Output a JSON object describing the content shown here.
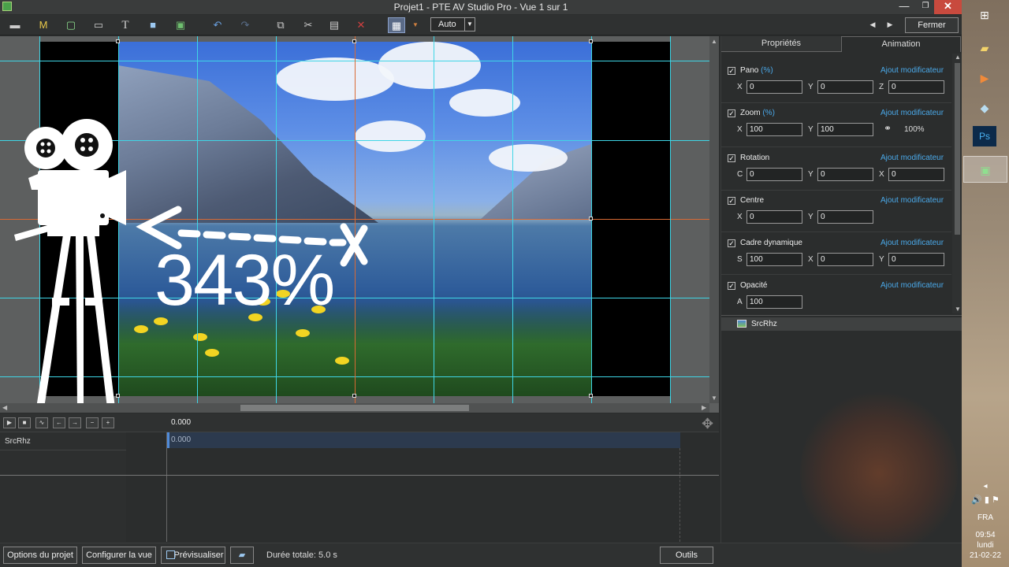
{
  "window": {
    "title": "Projet1 - PTE AV Studio Pro - Vue 1 sur 1",
    "minimize": "—",
    "maximize": "❐",
    "close": "✕"
  },
  "toolbar": {
    "m_label": "M",
    "t_label": "T",
    "auto_value": "Auto",
    "fermer_label": "Fermer"
  },
  "canvas": {
    "zoom_overlay": "343%"
  },
  "timeline": {
    "time_head": "0.000",
    "track_name": "SrcRhz",
    "track_time": "0.000"
  },
  "bottom": {
    "options_label": "Options du projet",
    "configure_label": "Configurer la vue",
    "preview_label": "Prévisualiser",
    "duration_text": "Durée totale: 5.0 s",
    "tools_label": "Outils"
  },
  "panel": {
    "tab_properties": "Propriétés",
    "tab_animation": "Animation",
    "add_modifier": "Ajout modificateur",
    "pano": {
      "title": "Pano",
      "unit": "(%)",
      "x_label": "X",
      "x": "0",
      "y_label": "Y",
      "y": "0",
      "z_label": "Z",
      "z": "0"
    },
    "zoom": {
      "title": "Zoom",
      "unit": "(%)",
      "x_label": "X",
      "x": "100",
      "y_label": "Y",
      "y": "100",
      "ratio": "100%"
    },
    "rotation": {
      "title": "Rotation",
      "c_label": "C",
      "c": "0",
      "y_label": "Y",
      "y": "0",
      "x_label": "X",
      "x": "0"
    },
    "centre": {
      "title": "Centre",
      "x_label": "X",
      "x": "0",
      "y_label": "Y",
      "y": "0"
    },
    "cadre": {
      "title": "Cadre dynamique",
      "s_label": "S",
      "s": "100",
      "x_label": "X",
      "x": "0",
      "y_label": "Y",
      "y": "0"
    },
    "opacite": {
      "title": "Opacité",
      "a_label": "A",
      "a": "100"
    },
    "slide_name": "SrcRhz"
  },
  "taskbar": {
    "lang": "FRA",
    "time": "09:54",
    "day": "lundi",
    "date": "21-02-22"
  },
  "colors": {
    "guide": "#3fd6e6",
    "guide_center": "#d96a34",
    "link": "#4aa8e8",
    "close_button": "#c84a3e"
  }
}
